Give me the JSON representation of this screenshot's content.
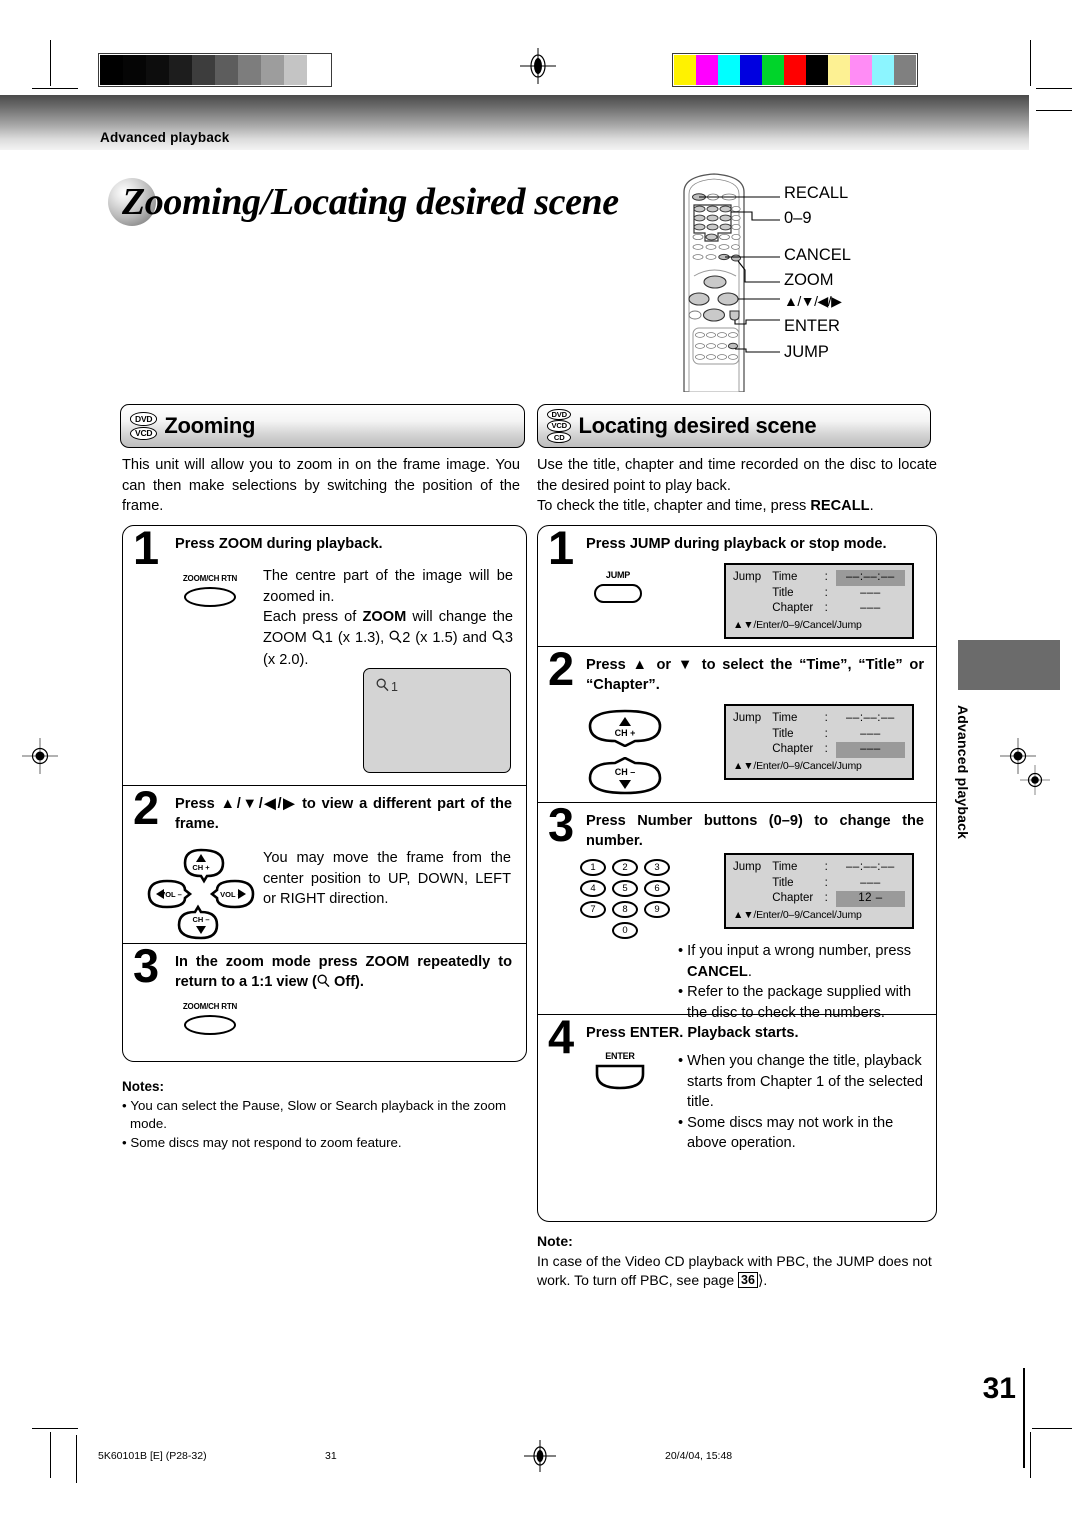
{
  "header": {
    "running_head": "Advanced playback"
  },
  "title": {
    "text": "Zooming/Locating desired scene"
  },
  "remote": {
    "callouts": [
      {
        "label": "RECALL"
      },
      {
        "label": "0–9"
      },
      {
        "label": "CANCEL"
      },
      {
        "label": "ZOOM"
      },
      {
        "label": "▲/▼/◀/▶"
      },
      {
        "label": "ENTER"
      },
      {
        "label": "JUMP"
      }
    ]
  },
  "left_section": {
    "badges": [
      "DVD",
      "VCD"
    ],
    "heading": "Zooming",
    "intro": "This unit will allow you to zoom in on the frame image. You can then make selections by switching the position of the frame.",
    "steps": [
      {
        "number": "1",
        "heading": "Press ZOOM during playback.",
        "button_label": "ZOOM/CH RTN",
        "body_line1": "The centre part of the image will be zoomed in.",
        "body_line2_prefix": "Each press of ",
        "body_line2_bold": "ZOOM",
        "body_line2_suffix": " will change the ZOOM ",
        "zoom_steps": "1 (x 1.3), ",
        "zoom_steps2": "2 (x 1.5) and ",
        "zoom_steps3": "3 (x 2.0).",
        "frame_label": "1"
      },
      {
        "number": "2",
        "heading": "Press ▲/▼/◀/▶ to view a different part of the frame.",
        "body": "You may move the frame from the center position to UP, DOWN, LEFT or RIGHT direction.",
        "pad": {
          "up": "CH +",
          "down": "CH –",
          "left": "VOL –",
          "right": "VOL +"
        }
      },
      {
        "number": "3",
        "heading_part1": "In the zoom mode press ZOOM repeatedly to return to a 1:1 view (",
        "heading_part2": " Off).",
        "button_label": "ZOOM/CH RTN"
      }
    ],
    "notes_title": "Notes:",
    "notes": [
      "You can select the Pause, Slow or Search playback in the zoom mode.",
      "Some discs may not respond to zoom feature."
    ]
  },
  "right_section": {
    "badges": [
      "DVD",
      "VCD",
      "CD"
    ],
    "heading": "Locating desired scene",
    "intro_line1": "Use the title, chapter and time recorded on the disc to locate the desired point to play back.",
    "intro_line2_prefix": "To check the title, chapter and time, press ",
    "intro_line2_bold": "RECALL",
    "intro_line2_suffix": ".",
    "steps": [
      {
        "number": "1",
        "heading": "Press JUMP during playback or stop mode.",
        "button_label": "JUMP",
        "osd": {
          "label": "Jump",
          "rows": [
            {
              "name": "Time",
              "sep": ":",
              "value": "––:––:––",
              "highlight": true
            },
            {
              "name": "Title",
              "sep": ":",
              "value": "–––",
              "highlight": false
            },
            {
              "name": "Chapter",
              "sep": ":",
              "value": "–––",
              "highlight": false
            }
          ],
          "footer": "▲▼/Enter/0–9/Cancel/Jump"
        }
      },
      {
        "number": "2",
        "heading": "Press ▲ or ▼ to select the “Time”, “Title” or “Chapter”.",
        "buttons": {
          "up": "CH +",
          "down": "CH –"
        },
        "osd": {
          "label": "Jump",
          "rows": [
            {
              "name": "Time",
              "sep": ":",
              "value": "––:––:––",
              "highlight": false
            },
            {
              "name": "Title",
              "sep": ":",
              "value": "–––",
              "highlight": false
            },
            {
              "name": "Chapter",
              "sep": ":",
              "value": "–––",
              "highlight": true
            }
          ],
          "footer": "▲▼/Enter/0–9/Cancel/Jump"
        }
      },
      {
        "number": "3",
        "heading": "Press Number buttons (0–9) to change the number.",
        "keys": [
          "1",
          "2",
          "3",
          "4",
          "5",
          "6",
          "7",
          "8",
          "9",
          "0"
        ],
        "osd": {
          "label": "Jump",
          "rows": [
            {
              "name": "Time",
              "sep": ":",
              "value": "––:––:––",
              "highlight": false
            },
            {
              "name": "Title",
              "sep": ":",
              "value": "–––",
              "highlight": false
            },
            {
              "name": "Chapter",
              "sep": ":",
              "value": "12 –",
              "highlight": true
            }
          ],
          "footer": "▲▼/Enter/0–9/Cancel/Jump"
        },
        "bullet1_prefix": "If you input a wrong number, press ",
        "bullet1_bold": "CANCEL",
        "bullet1_suffix": ".",
        "bullet2": "Refer to the package supplied with the disc to check the numbers."
      },
      {
        "number": "4",
        "heading": "Press ENTER. Playback starts.",
        "button_label": "ENTER",
        "bullet1": "When you change the title, playback starts from Chapter 1 of the selected title.",
        "bullet2": "Some discs may not work in the above operation."
      }
    ],
    "note_title": "Note:",
    "note_part1": "In case of the Video CD playback with PBC, the JUMP does not work. To turn off PBC, see page ",
    "note_page_ref": "36",
    "note_part2": "⟩."
  },
  "side_tab": {
    "label": "Advanced playback"
  },
  "page_number": "31",
  "footer": {
    "doc_code": "5K60101B [E] (P28-32)",
    "page": "31",
    "timestamp": "20/4/04, 15:48"
  },
  "calibration": {
    "gray_swatches": [
      "#000000",
      "#050505",
      "#0d0d0d",
      "#1d1d1d",
      "#3d3d3d",
      "#5d5d5d",
      "#7d7d7d",
      "#9d9d9d",
      "#c4c4c4",
      "#ffffff"
    ],
    "color_swatches": [
      "#fff200",
      "#ff00ff",
      "#00ffff",
      "#0000e0",
      "#00d42a",
      "#ff0000",
      "#000000",
      "#fdf193",
      "#ff8cf5",
      "#8cf5ff",
      "#808080"
    ]
  }
}
